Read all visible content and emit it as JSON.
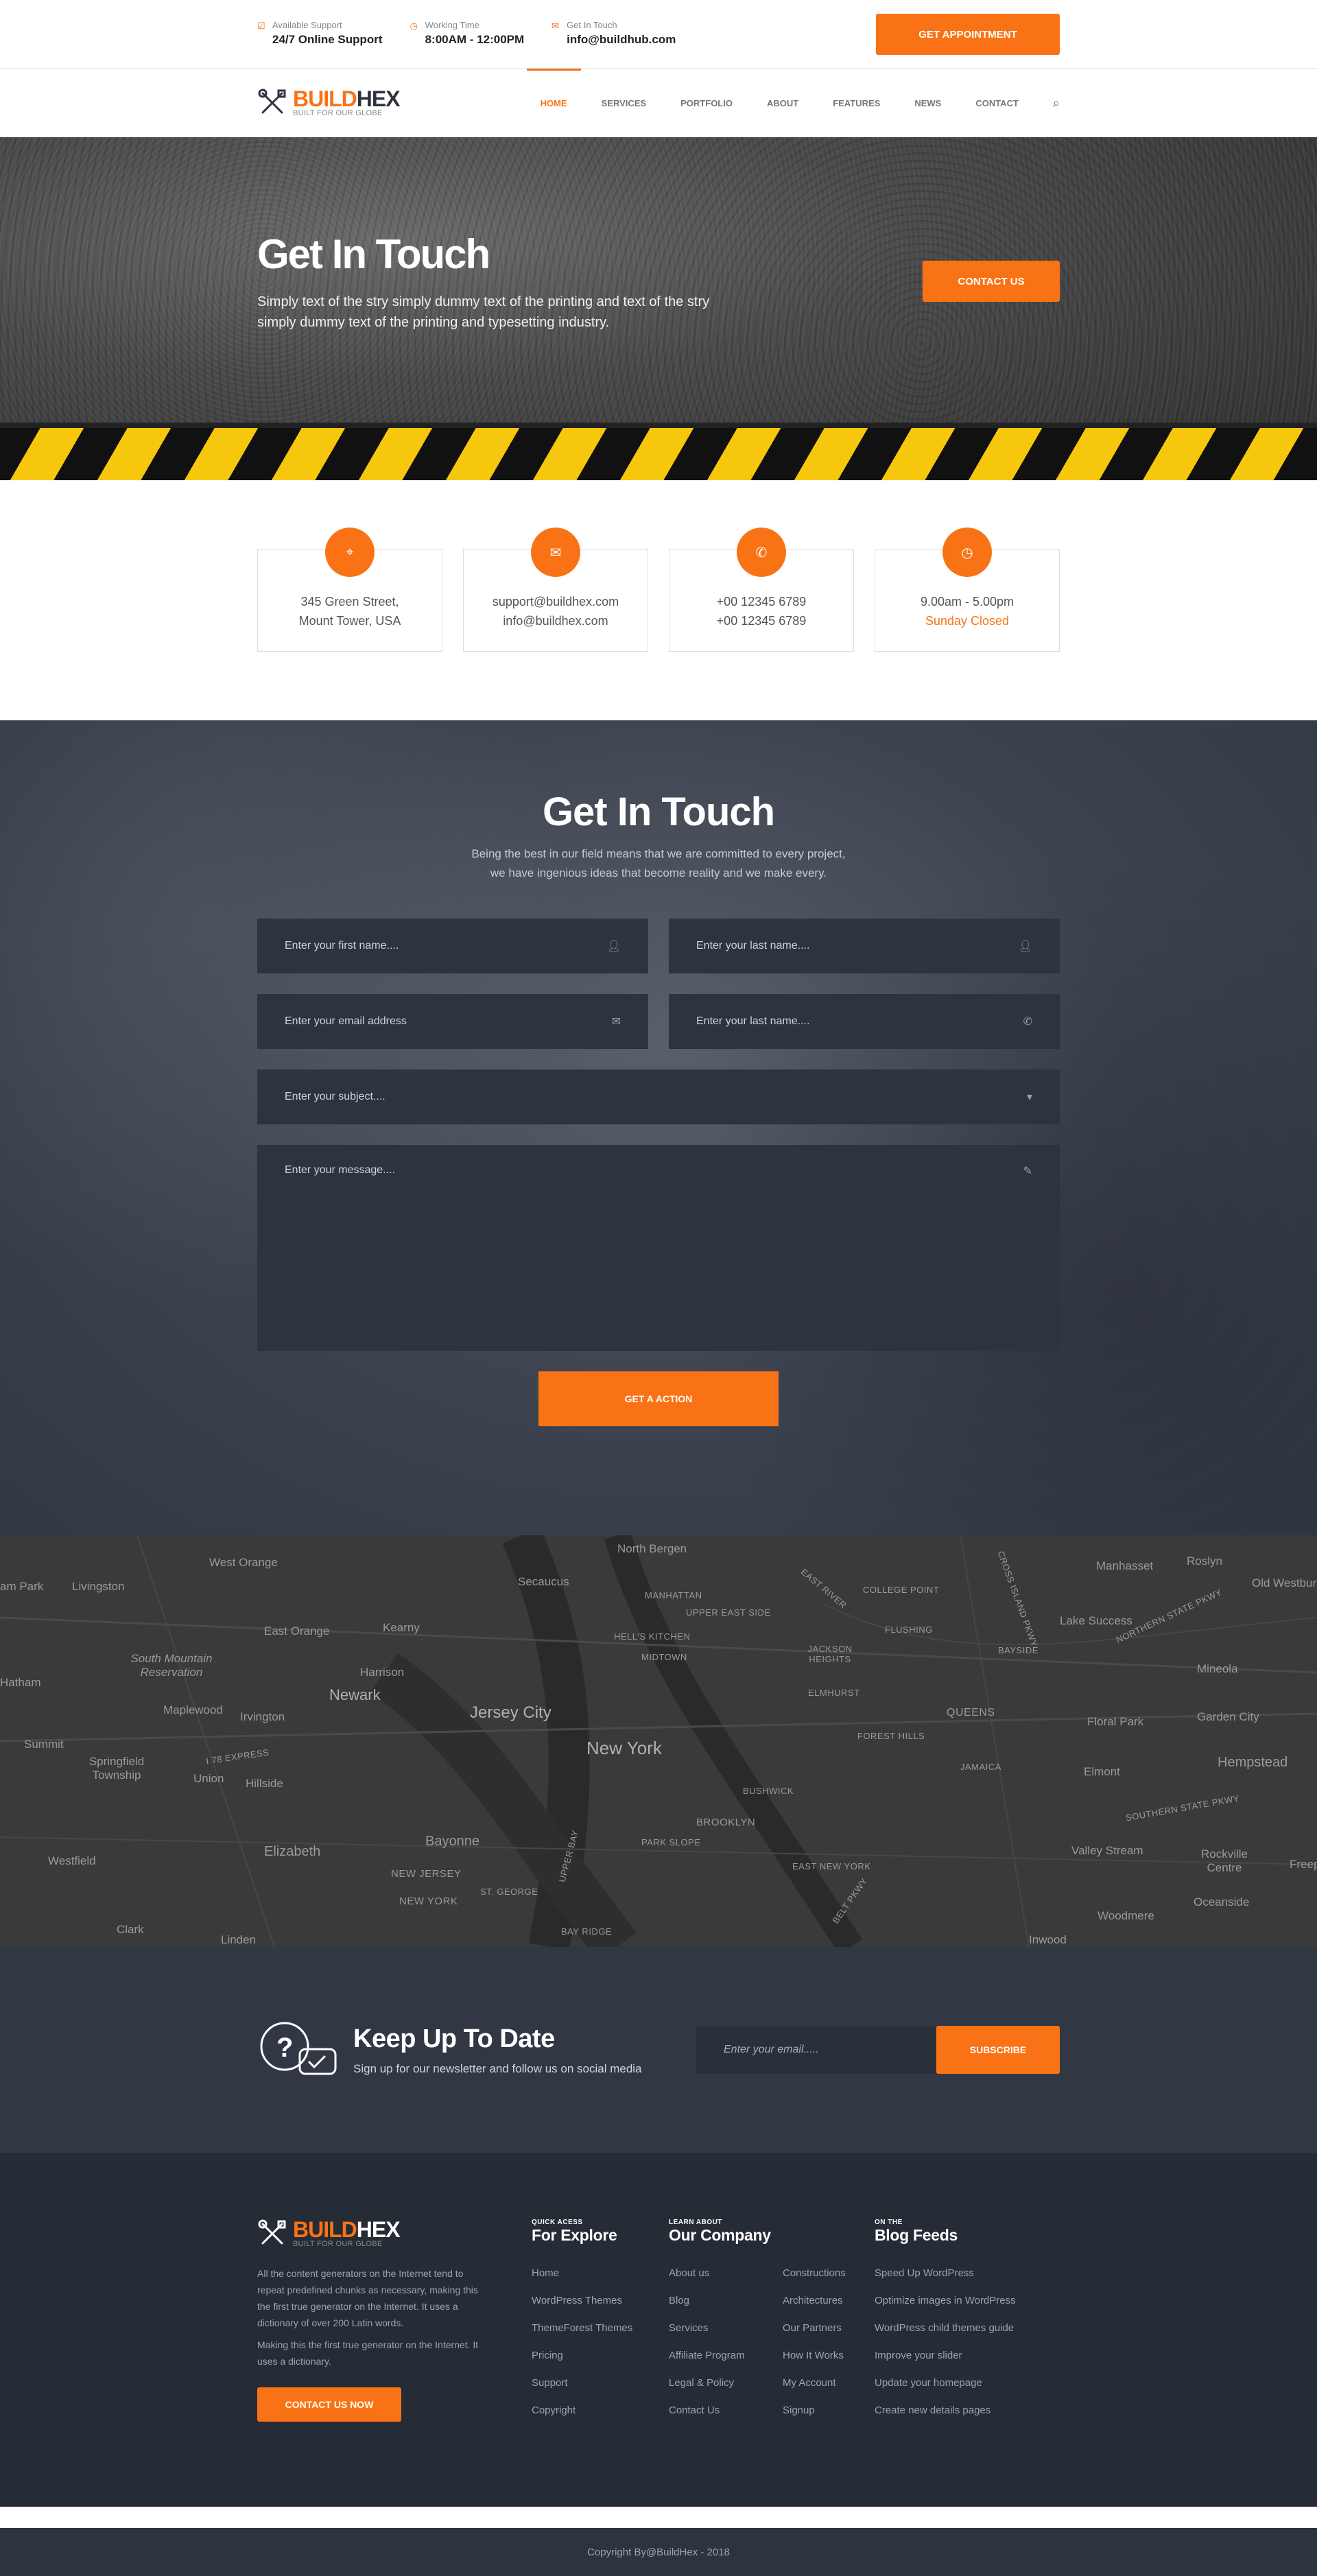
{
  "topbar": {
    "items": [
      {
        "icon": "check-square-icon",
        "small": "Available Support",
        "big": "24/7 Online Support"
      },
      {
        "icon": "clock-icon",
        "small": "Working Time",
        "big": "8:00AM - 12:00PM"
      },
      {
        "icon": "envelope-icon",
        "small": "Get In Touch",
        "big": "info@buildhub.com"
      }
    ],
    "appointment_label": "GET APPOINTMENT"
  },
  "brand": {
    "name_a": "BUILD",
    "name_b": "HEX",
    "tagline": "BUILT FOR OUR GLOBE"
  },
  "nav": {
    "items": [
      "HOME",
      "SERVICES",
      "PORTFOLIO",
      "ABOUT",
      "FEATURES",
      "NEWS",
      "CONTACT"
    ],
    "active": "HOME"
  },
  "hero": {
    "title": "Get In Touch",
    "text": "Simply text of the stry simply dummy text of the printing and text of the stry simply dummy text of the printing and typesetting industry.",
    "button": "CONTACT US"
  },
  "cards": [
    {
      "icon": "map-pin-icon",
      "line1": "345 Green Street,",
      "line2": "Mount Tower, USA"
    },
    {
      "icon": "envelope-icon",
      "line1": "support@buildhex.com",
      "line2": "info@buildhex.com"
    },
    {
      "icon": "phone-icon",
      "line1": "+00 12345 6789",
      "line2": "+00 12345 6789"
    },
    {
      "icon": "clock-icon",
      "line1": "9.00am - 5.00pm",
      "line2": "Sunday Closed"
    }
  ],
  "contact_form": {
    "title": "Get In Touch",
    "sub1": "Being the best in our field means that we are committed to every project,",
    "sub2": "we have ingenious ideas that become reality and we make every.",
    "first_name": "Enter your first name....",
    "last_name": "Enter your last name....",
    "email": "Enter your email address",
    "phone": "Enter your last name....",
    "subject": "Enter your subject....",
    "message": "Enter your message....",
    "button": "GET A ACTION"
  },
  "map": {
    "labels": [
      "North Bergen",
      "West Orange",
      "Livingston",
      "Secaucus",
      "MANHATTAN",
      "UPPER EAST SIDE",
      "HELL'S KITCHEN",
      "MIDTOWN",
      "East Orange",
      "Kearny",
      "Harrison",
      "South Mountain Reservation",
      "Maplewood",
      "Irvington",
      "Newark",
      "Jersey City",
      "New York",
      "Summit",
      "Springfield Township",
      "Union",
      "Hillside",
      "Westfield",
      "Elizabeth",
      "Bayonne",
      "NEW JERSEY",
      "NEW YORK",
      "ST. GEORGE",
      "BROOKLYN",
      "PARK SLOPE",
      "BAY RIDGE",
      "Clark",
      "Linden",
      "JACKSON HEIGHTS",
      "ELMHURST",
      "FOREST HILLS",
      "QUEENS",
      "JAMAICA",
      "BUSHWICK",
      "EAST NEW YORK",
      "FLUSHING",
      "COLLEGE POINT",
      "BAYSIDE",
      "Manhasset",
      "Roslyn",
      "Old Westbury",
      "Lake Success",
      "Mineola",
      "Garden City",
      "Floral Park",
      "Elmont",
      "Hempstead",
      "Valley Stream",
      "Rockville Centre",
      "Woodmere",
      "Oceanside",
      "Inwood",
      "Freeport",
      "Hatham",
      "am Park",
      "Belt Pkwy",
      "Southern State Pkwy",
      "Northern State Pkwy",
      "Upper Bay",
      "East River",
      "Cross Island Pkwy",
      "I 78 Express"
    ]
  },
  "newsletter": {
    "title": "Keep Up To Date",
    "sub": "Sign up for our newsletter and follow us on social media",
    "placeholder": "Enter your email.....",
    "button": "SUBSCRIBE"
  },
  "footer": {
    "about1": "All the content generators on the Internet tend to repeat predefined chunks as necessary, making this the first true generator on the Internet. It uses a dictionary of over 200 Latin words.",
    "about2": "Making this the first true generator on the Internet. It uses a dictionary.",
    "button": "CONTACT US NOW",
    "explore": {
      "kicker": "QUICK ACESS",
      "title": "For Explore",
      "links": [
        "Home",
        "WordPress Themes",
        "ThemeForest Themes",
        "Pricing",
        "Support",
        "Copyright"
      ]
    },
    "company": {
      "kicker": "LEARN ABOUT",
      "title": "Our Company",
      "links_a": [
        "About us",
        "Blog",
        "Services",
        "Affiliate Program",
        "Legal & Policy",
        "Contact Us"
      ],
      "links_b": [
        "Constructions",
        "Architectures",
        "Our Partners",
        "How It Works",
        "My Account",
        "Signup"
      ]
    },
    "blog": {
      "kicker": "ON THE",
      "title": "Blog Feeds",
      "links": [
        "Speed Up WordPress",
        "Optimize images in WordPress",
        "WordPress child themes guide",
        "Improve your slider",
        "Update your homepage",
        "Create new details pages"
      ]
    },
    "copyright": "Copyright By@BuildHex - 2018"
  },
  "colors": {
    "accent": "#f97316",
    "dark": "#2d3440",
    "footer": "#262c36"
  }
}
